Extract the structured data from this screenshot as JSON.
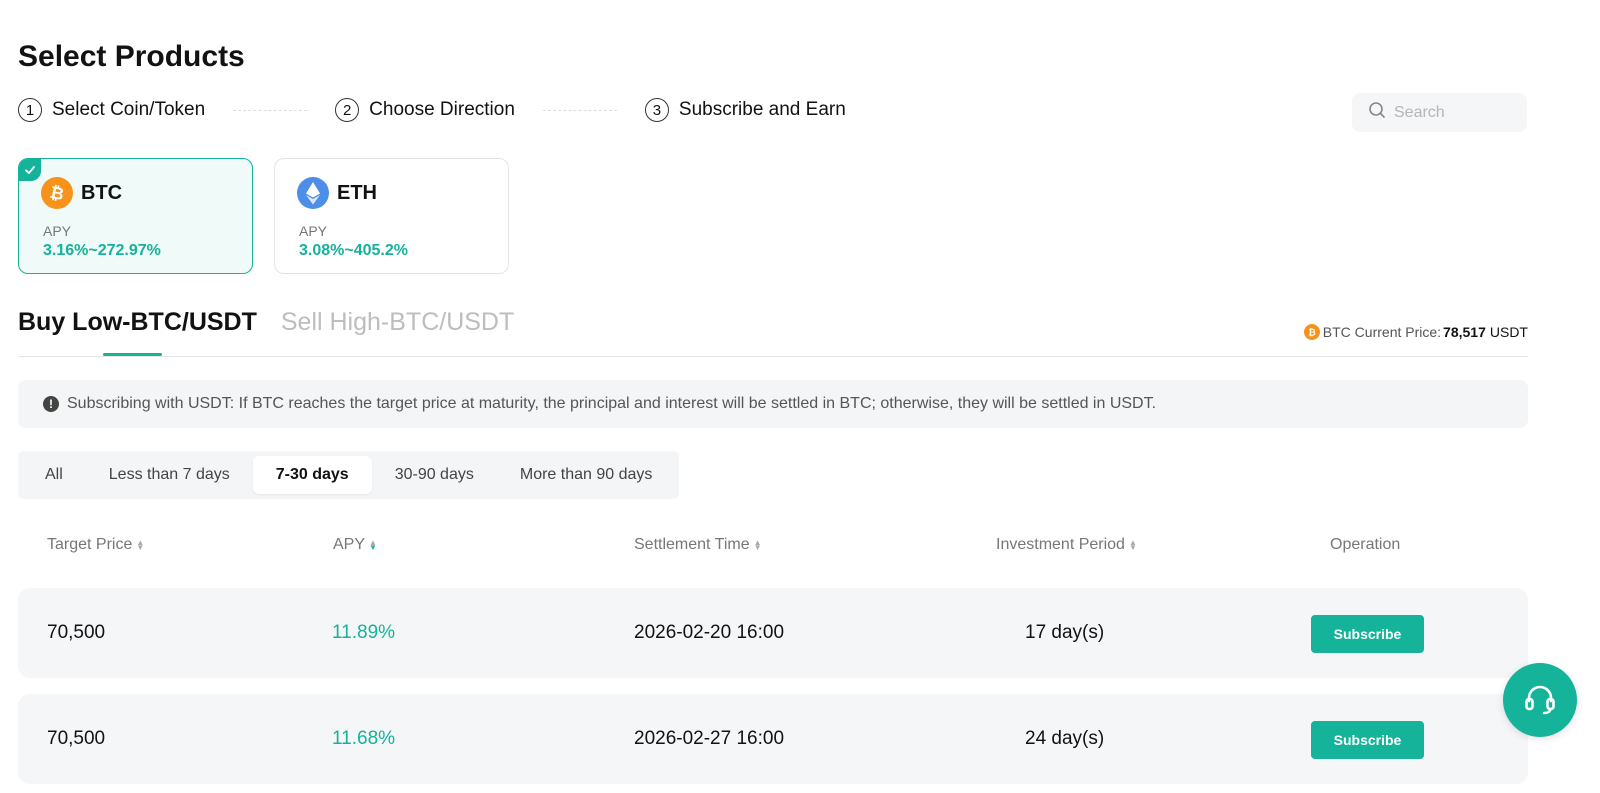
{
  "page": {
    "title": "Select Products"
  },
  "steps": [
    {
      "num": "1",
      "label": "Select Coin/Token"
    },
    {
      "num": "2",
      "label": "Choose Direction"
    },
    {
      "num": "3",
      "label": "Subscribe and Earn"
    }
  ],
  "search": {
    "placeholder": "Search"
  },
  "coins": [
    {
      "symbol": "BTC",
      "apy_label": "APY",
      "apy_range": "3.16%~272.97%",
      "selected": true,
      "icon": "bitcoin-icon",
      "color": "#f7931a"
    },
    {
      "symbol": "ETH",
      "apy_label": "APY",
      "apy_range": "3.08%~405.2%",
      "selected": false,
      "icon": "ethereum-icon",
      "color": "#4d8ee8"
    }
  ],
  "direction_tabs": [
    {
      "label": "Buy Low-BTC/USDT",
      "active": true
    },
    {
      "label": "Sell High-BTC/USDT",
      "active": false
    }
  ],
  "price": {
    "label": "BTC Current Price:",
    "value": "78,517",
    "unit": "USDT"
  },
  "notice": {
    "text": "Subscribing with USDT: If BTC reaches the target price at maturity, the principal and interest will be settled in BTC; otherwise, they will be settled in USDT."
  },
  "period_filter": {
    "options": [
      "All",
      "Less than 7 days",
      "7-30 days",
      "30-90 days",
      "More than 90 days"
    ],
    "selected": "7-30 days"
  },
  "table": {
    "columns": [
      "Target Price",
      "APY",
      "Settlement Time",
      "Investment Period",
      "Operation"
    ],
    "rows": [
      {
        "target_price": "70,500",
        "apy": "11.89%",
        "settlement_time": "2026-02-20 16:00",
        "period": "17 day(s)",
        "action": "Subscribe"
      },
      {
        "target_price": "70,500",
        "apy": "11.68%",
        "settlement_time": "2026-02-27 16:00",
        "period": "24 day(s)",
        "action": "Subscribe"
      }
    ]
  },
  "colors": {
    "accent": "#14b39a",
    "btc": "#f7931a",
    "eth": "#4d8ee8"
  }
}
